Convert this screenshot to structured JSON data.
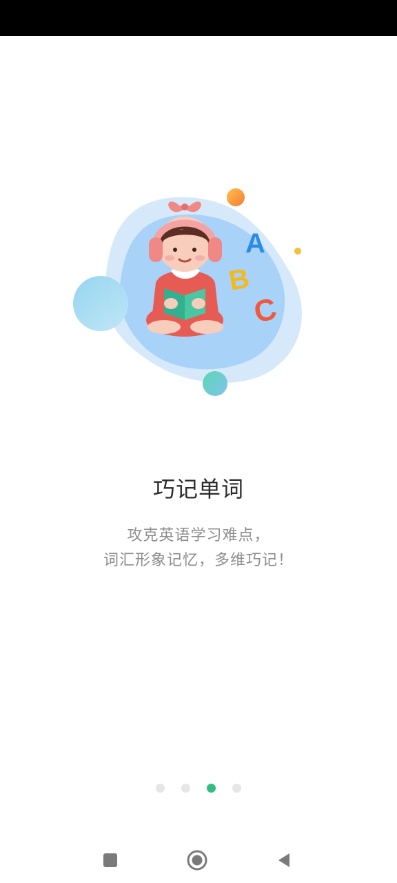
{
  "onboarding": {
    "title": "巧记单词",
    "description_line1": "攻克英语学习难点，",
    "description_line2": "词汇形象记忆，多维巧记！",
    "illustration": {
      "name": "girl-reading-abc-illustration",
      "letters": [
        "A",
        "B",
        "C"
      ],
      "letter_colors": {
        "A": "#2b8be8",
        "B": "#f6b91a",
        "C": "#f0593a"
      }
    },
    "pager": {
      "total": 4,
      "active_index": 2,
      "active_color": "#2fbf82",
      "inactive_color": "#e6e6e6"
    }
  },
  "system_nav": {
    "recents_icon": "square-icon",
    "home_icon": "circle-home-icon",
    "back_icon": "triangle-back-icon"
  }
}
